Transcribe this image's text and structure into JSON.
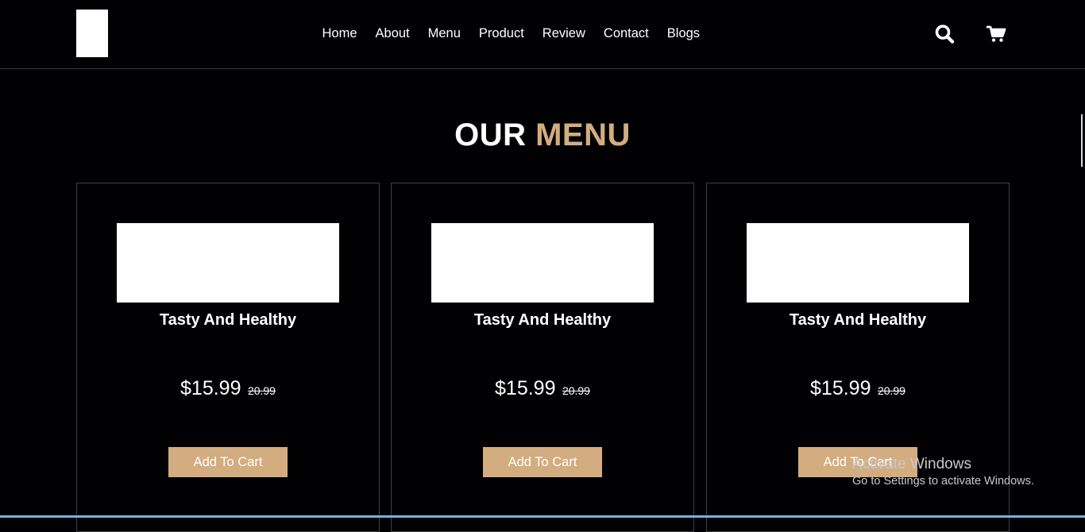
{
  "header": {
    "nav": [
      "Home",
      "About",
      "Menu",
      "Product",
      "Review",
      "Contact",
      "Blogs"
    ]
  },
  "icons": {
    "search": "search-icon",
    "cart": "shopping-cart-icon"
  },
  "section": {
    "title_main": "OUR",
    "title_accent": "MENU"
  },
  "colors": {
    "accent": "#d3ad7f",
    "background": "#010103",
    "border": "#3f3f3f"
  },
  "menu": {
    "items": [
      {
        "name": "Tasty And Healthy",
        "price": "$15.99",
        "old_price": "20.99",
        "button": "Add To Cart"
      },
      {
        "name": "Tasty And Healthy",
        "price": "$15.99",
        "old_price": "20.99",
        "button": "Add To Cart"
      },
      {
        "name": "Tasty And Healthy",
        "price": "$15.99",
        "old_price": "20.99",
        "button": "Add To Cart"
      }
    ]
  },
  "os_overlay": {
    "line1": "Activate Windows",
    "line2": "Go to Settings to activate Windows."
  }
}
